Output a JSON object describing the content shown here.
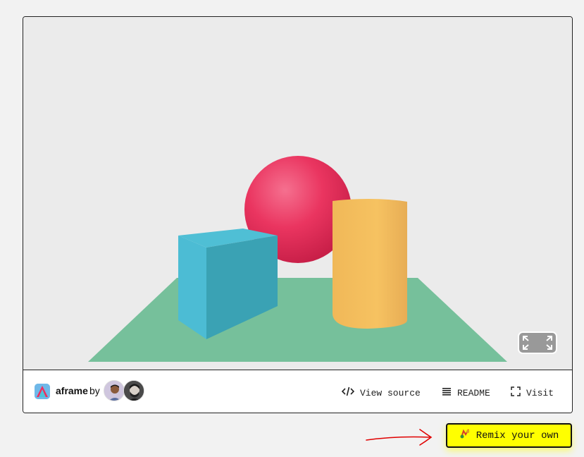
{
  "project": {
    "name": "aframe",
    "by": "by",
    "avatar_icon": "aframe-logo-icon"
  },
  "users": [
    {
      "avatar": "user-avatar-1"
    },
    {
      "avatar": "user-avatar-2"
    }
  ],
  "footer_links": {
    "source": {
      "label": "View source",
      "icon": "code-icon"
    },
    "readme": {
      "label": "README",
      "icon": "list-icon"
    },
    "visit": {
      "label": "Visit",
      "icon": "expand-icon"
    }
  },
  "remix": {
    "label": "Remix your own",
    "icon": "remix-icon"
  },
  "colors": {
    "accent": "#ffff00",
    "sphere": "#ef2d5e",
    "cylinder": "#ffc65d",
    "box": "#4cc3d9",
    "plane": "#7bc8a4",
    "annotation": "#e00000"
  }
}
